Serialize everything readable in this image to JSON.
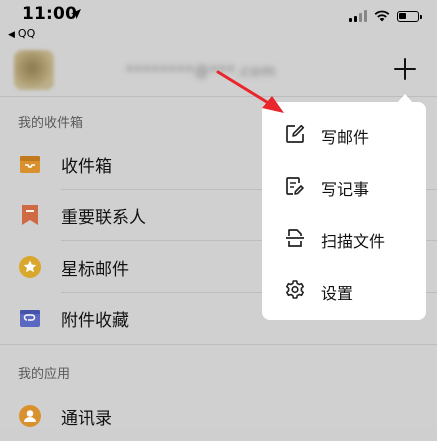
{
  "status_bar": {
    "time": "11:00",
    "back_app": "QQ",
    "battery_level": 0.45
  },
  "account": {
    "email_redacted": "********@***.com"
  },
  "sections": {
    "mailboxes_label": "我的收件箱",
    "apps_label": "我的应用"
  },
  "mailbox_items": [
    {
      "label": "收件箱",
      "icon": "inbox-icon",
      "color": "#d9912e"
    },
    {
      "label": "重要联系人",
      "icon": "bookmark-icon",
      "color": "#cf6a45"
    },
    {
      "label": "星标邮件",
      "icon": "star-icon",
      "color": "#d8a72c"
    },
    {
      "label": "附件收藏",
      "icon": "attachment-folder-icon",
      "color": "#5a68c2"
    }
  ],
  "app_items": [
    {
      "label": "通讯录",
      "icon": "contacts-icon",
      "color": "#d9912e"
    }
  ],
  "popup_menu": {
    "items": [
      {
        "label": "写邮件",
        "icon": "compose-icon"
      },
      {
        "label": "写记事",
        "icon": "note-icon"
      },
      {
        "label": "扫描文件",
        "icon": "scan-icon"
      },
      {
        "label": "设置",
        "icon": "gear-icon"
      }
    ]
  },
  "colors": {
    "overlay_bg": "#d0d0d0",
    "annotation_arrow": "#e8262b"
  }
}
